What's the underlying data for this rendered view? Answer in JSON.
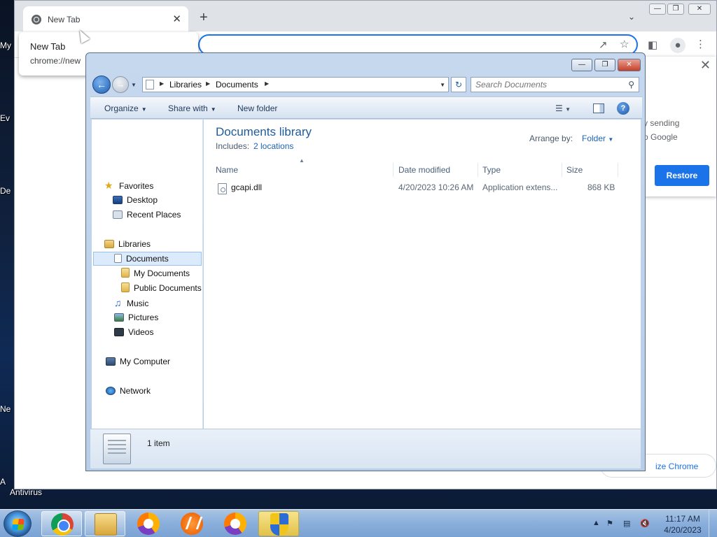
{
  "desktop": {
    "icon_labels": [
      "My",
      "Ev",
      "De",
      "Ne",
      "A"
    ],
    "antivirus_label": "Antivirus"
  },
  "chrome": {
    "tab_title": "New Tab",
    "hover_card": {
      "title": "New Tab",
      "url": "chrome://new"
    },
    "restore_panel": {
      "text1": "y sending",
      "text2": "o Google",
      "restore_label": "Restore"
    },
    "customize_label": "ize Chrome",
    "new_tab_symbol": "+",
    "close_symbol": "✕"
  },
  "explorer": {
    "breadcrumb": [
      "Libraries",
      "Documents"
    ],
    "search_placeholder": "Search Documents",
    "commands": {
      "organize": "Organize",
      "share_with": "Share with",
      "new_folder": "New folder"
    },
    "nav": {
      "favorites": "Favorites",
      "desktop": "Desktop",
      "recent_places": "Recent Places",
      "libraries": "Libraries",
      "documents": "Documents",
      "my_documents": "My Documents",
      "public_documents": "Public Documents",
      "music": "Music",
      "pictures": "Pictures",
      "videos": "Videos",
      "my_computer": "My Computer",
      "network": "Network"
    },
    "library": {
      "title": "Documents library",
      "includes_label": "Includes:",
      "locations_link": "2 locations",
      "arrange_label": "Arrange by:",
      "arrange_value": "Folder"
    },
    "columns": {
      "name": "Name",
      "date_modified": "Date modified",
      "type": "Type",
      "size": "Size"
    },
    "files": [
      {
        "name": "gcapi.dll",
        "date_modified": "4/20/2023 10:26 AM",
        "type": "Application extens...",
        "size": "868 KB"
      }
    ],
    "details": {
      "count": "1 item"
    }
  },
  "taskbar": {
    "clock_time": "11:17 AM",
    "clock_date": "4/20/2023"
  }
}
